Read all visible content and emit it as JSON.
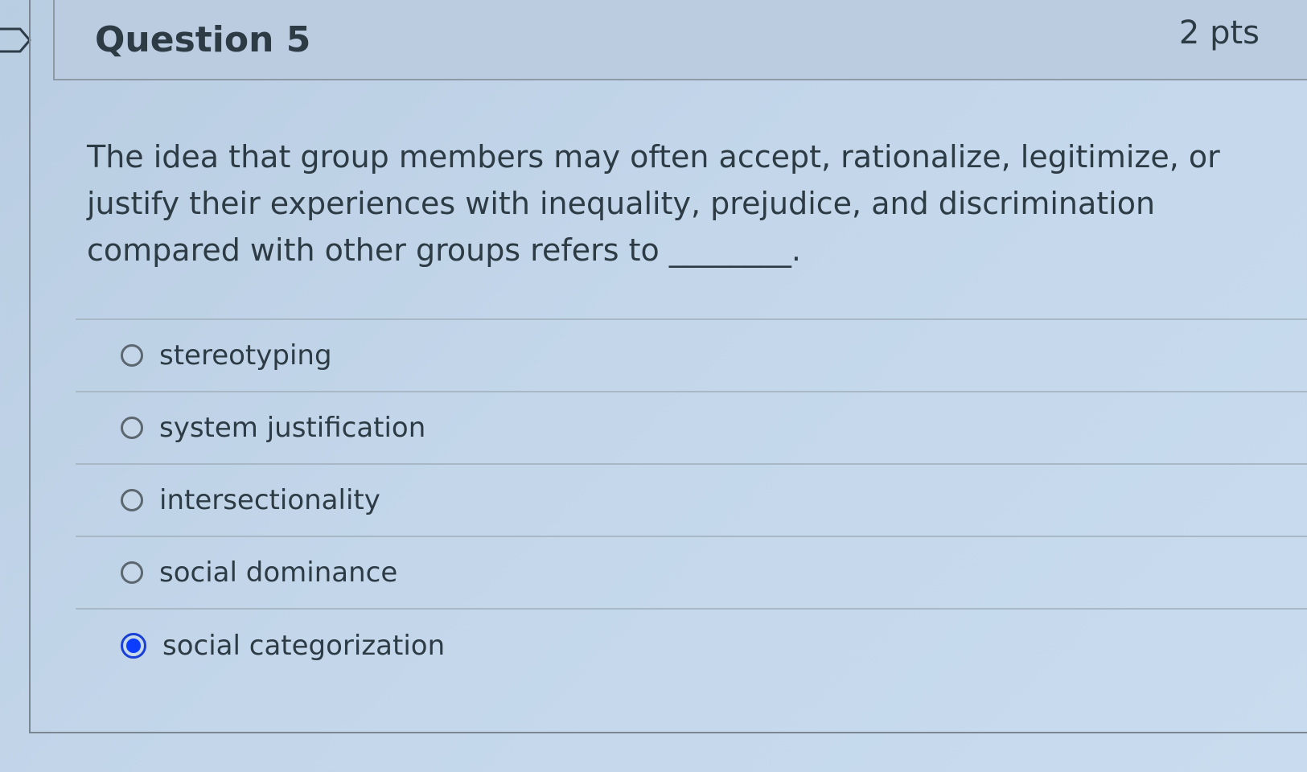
{
  "question": {
    "title": "Question 5",
    "points": "2 pts",
    "text": "The idea that group members may often accept, rationalize, legitimize, or justify their experiences with inequality, prejudice, and discrimination compared with other groups refers to ________."
  },
  "answers": [
    {
      "label": "stereotyping",
      "selected": false
    },
    {
      "label": "system justification",
      "selected": false
    },
    {
      "label": "intersectionality",
      "selected": false
    },
    {
      "label": "social dominance",
      "selected": false
    },
    {
      "label": "social categorization",
      "selected": true
    }
  ],
  "colors": {
    "selected_radio": "#0b3cff",
    "text": "#2d3b45",
    "header_bg": "#bccce0"
  }
}
